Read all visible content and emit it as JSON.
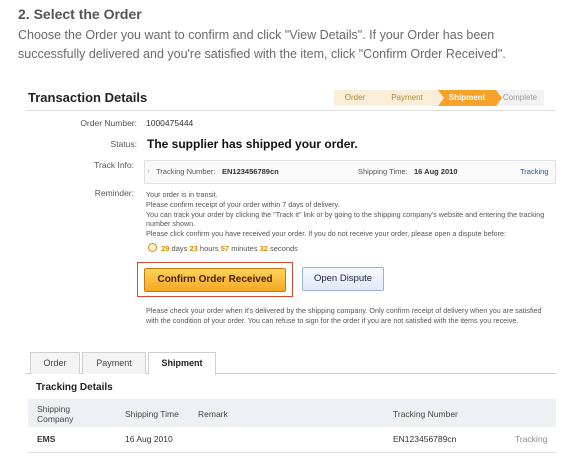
{
  "heading": "2. Select the Order",
  "intro": "Choose the Order you want to confirm and click \"View Details\". If your Order has been successfully delivered and you're satisfied with the item, click \"Confirm Order Received\".",
  "transaction": {
    "title": "Transaction Details",
    "steps": [
      "Order",
      "Payment",
      "Shipment",
      "Complete"
    ],
    "active_step": "Shipment"
  },
  "details": {
    "order_number_label": "Order Number:",
    "order_number": "1000475444",
    "status_label": "Status:",
    "status": "The supplier has shipped your order.",
    "track_label": "Track Info:",
    "tracking_number_label": "Tracking Number:",
    "tracking_number": "EN123456789cn",
    "shipping_time_label": "Shipping Time:",
    "shipping_time": "16 Aug 2010",
    "tracking_link": "Tracking",
    "reminder_label": "Reminder:",
    "reminder_lines": [
      "Your order is in transit.",
      "Please confirm receipt of your order within 7 days of delivery.",
      "You can track your order by clicking the \"Track it\" link or by going to the shipping company's website and entering the tracking number shown.",
      "Please click confirm you have received your order. If you do not receive your order, please open a dispute before:"
    ],
    "countdown": {
      "days": "29",
      "days_label": "days",
      "hours": "23",
      "hours_label": "hours",
      "minutes": "57",
      "minutes_label": "minutes",
      "seconds": "32",
      "seconds_label": "seconds"
    },
    "confirm_button": "Confirm Order Received",
    "dispute_button": "Open Dispute",
    "note": "Please check your order when it's delivered by the shipping company. Only confirm receipt of delivery when you are satisfied with the condition of your order. You can refuse to sign for the order if you are not satisfied with the items you receive."
  },
  "tabs": [
    "Order",
    "Payment",
    "Shipment"
  ],
  "active_tab": "Shipment",
  "tracking_details": {
    "title": "Tracking Details",
    "columns": [
      "Shipping Company",
      "Shipping Time",
      "Remark",
      "Tracking Number"
    ],
    "rows": [
      {
        "company": "EMS",
        "time": "16 Aug 2010",
        "remark": "",
        "number": "EN123456789cn",
        "link": "Tracking"
      }
    ]
  }
}
